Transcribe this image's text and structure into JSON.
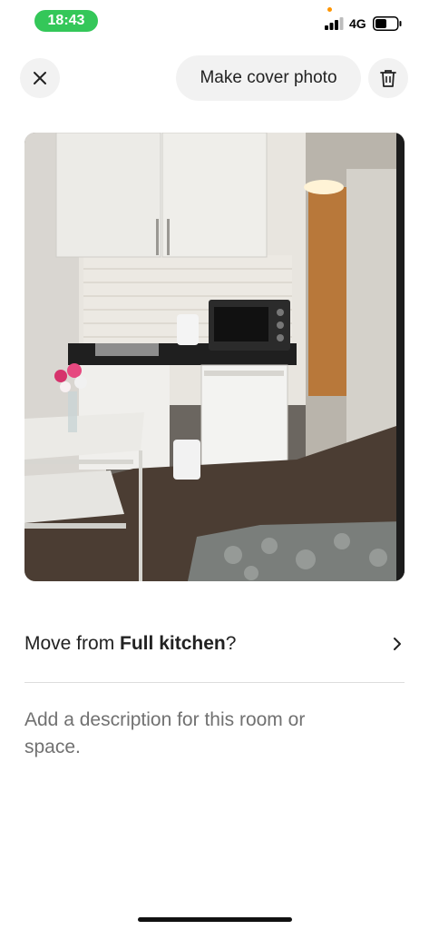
{
  "status_bar": {
    "time": "18:43",
    "network": "4G",
    "signal_icon": "cellular-signal-icon",
    "battery_icon": "battery-icon",
    "time_pill_color": "#34c759"
  },
  "toolbar": {
    "close_icon": "close-icon",
    "cover_label": "Make cover photo",
    "trash_icon": "trash-icon"
  },
  "photo": {
    "subject": "kitchen-room-photo"
  },
  "move_row": {
    "prefix": "Move from ",
    "room": "Full kitchen",
    "suffix": "?",
    "chevron_icon": "chevron-right-icon"
  },
  "description": {
    "placeholder": "Add a description for this room or space."
  }
}
